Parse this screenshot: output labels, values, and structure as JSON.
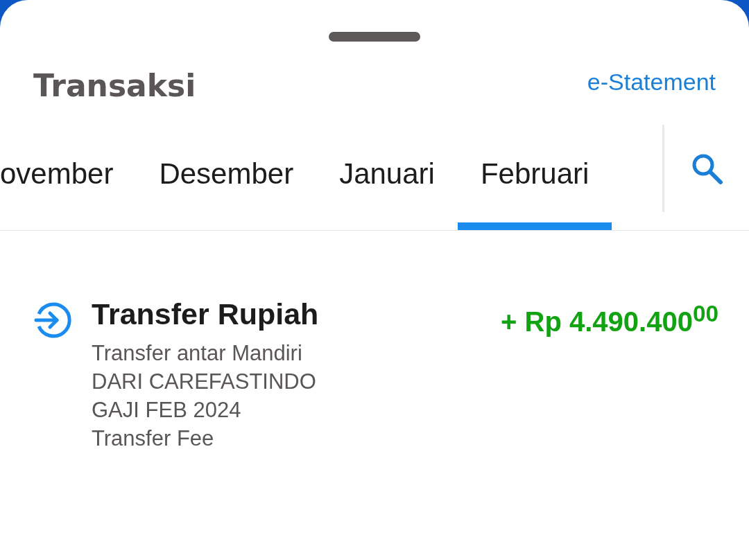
{
  "title": "Transaksi",
  "statement_link": "e-Statement",
  "tabs": [
    {
      "label": "ovember",
      "selected": false
    },
    {
      "label": "Desember",
      "selected": false
    },
    {
      "label": "Januari",
      "selected": false
    },
    {
      "label": "Februari",
      "selected": true
    }
  ],
  "transactions": [
    {
      "kind": "incoming",
      "title": "Transfer Rupiah",
      "details": [
        "Transfer antar Mandiri",
        "DARI CAREFASTINDO",
        "GAJI FEB 2024",
        "Transfer Fee"
      ],
      "amount": "+ Rp 4.490.400$^{00}$"
    }
  ]
}
